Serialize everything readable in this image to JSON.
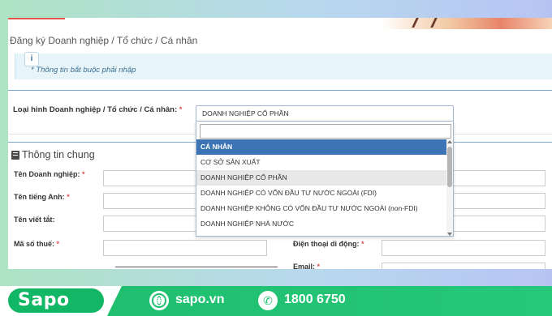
{
  "breadcrumb": "Đăng ký Doanh nghiệp / Tổ chức / Cá nhân",
  "info": {
    "icon": "info-icon",
    "text": "* Thông tin bắt buộc phải nhập"
  },
  "type_field": {
    "label": "Loại hình Doanh nghiệp / Tổ chức / Cá nhân:",
    "required": "*",
    "selected": "DOANH NGHIỆP CỔ PHẦN",
    "search_value": "",
    "options": [
      "CÁ NHÂN",
      "CƠ SỞ SẢN XUẤT",
      "DOANH NGHIỆP CỔ PHẦN",
      "DOANH NGHIỆP CÓ VỐN ĐẦU TƯ NƯỚC NGOÀI (FDI)",
      "DOANH NGHIỆP KHÔNG CÓ VỐN ĐẦU TƯ NƯỚC NGOÀI (non-FDI)",
      "DOANH NGHIỆP NHÀ NƯỚC"
    ],
    "highlighted_index": 0,
    "selected_index": 2
  },
  "general": {
    "title": "Thông tin chung",
    "fields": [
      {
        "label": "Tên Doanh nghiệp:",
        "required": "*"
      },
      {
        "label": "Tên tiếng Anh:",
        "required": "*"
      },
      {
        "label": "Tên viết tắt:",
        "required": ""
      },
      {
        "label": "Mã số thuế:",
        "required": "*"
      }
    ],
    "right_fields": [
      {
        "label": "Điện thoại di động:",
        "required": "*"
      },
      {
        "label": "Email:",
        "required": "*"
      }
    ]
  },
  "banner": {
    "logo": "Sapo",
    "website": "sapo.vn",
    "phone": "1800 6750",
    "colors": {
      "green": "#1fbf6f",
      "highlight": "#3c74b6"
    }
  }
}
